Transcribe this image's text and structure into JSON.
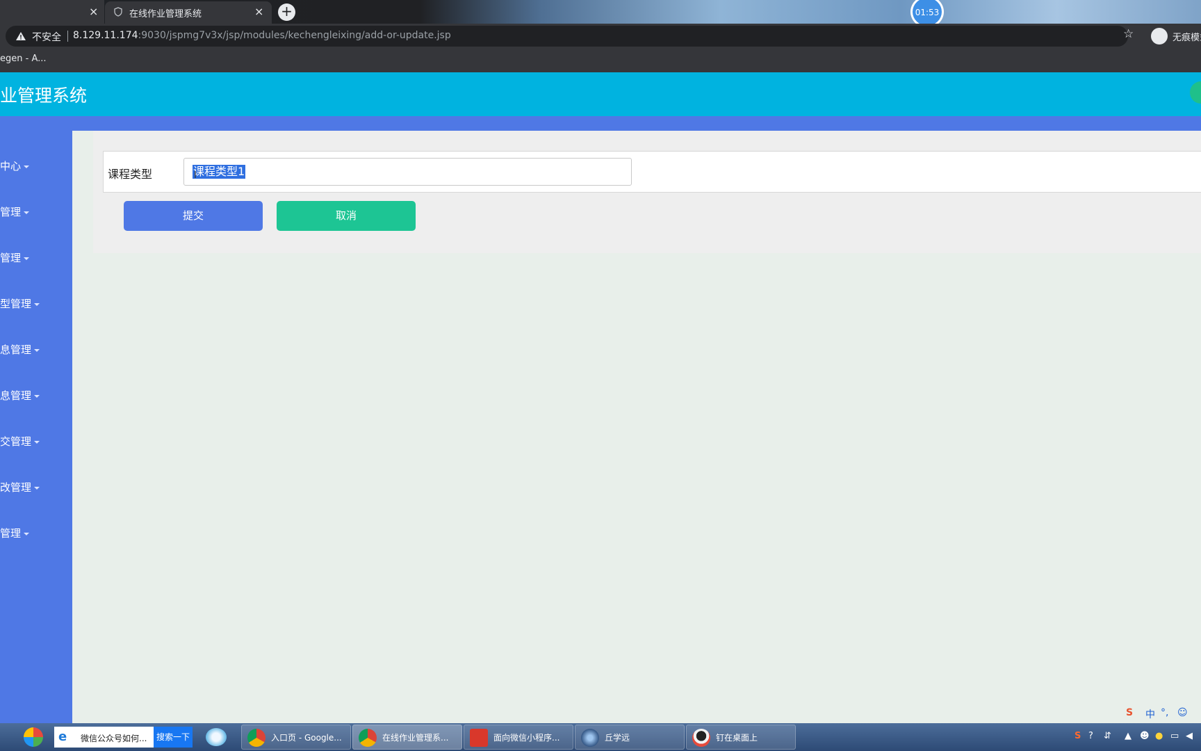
{
  "browser": {
    "prev_tab_close": "×",
    "active_tab": {
      "title": "在线作业管理系统",
      "close": "×"
    },
    "new_tab": "+",
    "timer": "01:53",
    "security_label": "不安全",
    "url_host": "8.129.11.174",
    "url_rest": ":9030/jspmg7v3x/jsp/modules/kechengleixing/add-or-update.jsp",
    "star": "☆",
    "incognito_label": "无痕模式",
    "bookmark": "egen - A..."
  },
  "app": {
    "title": "业管理系统"
  },
  "sidebar": {
    "items": [
      {
        "label": "中心"
      },
      {
        "label": "管理"
      },
      {
        "label": "管理"
      },
      {
        "label": "型管理"
      },
      {
        "label": "息管理"
      },
      {
        "label": "息管理"
      },
      {
        "label": "交管理"
      },
      {
        "label": "改管理"
      },
      {
        "label": "管理"
      }
    ]
  },
  "form": {
    "field_label": "课程类型",
    "field_value": "课程类型1",
    "submit_label": "提交",
    "cancel_label": "取消"
  },
  "ime": {
    "s": "S",
    "lang": "中",
    "punct": "°,",
    "face": "☺"
  },
  "taskbar": {
    "ie_search_text": "微信公众号如何...",
    "search_button": "搜索一下",
    "items": [
      {
        "label": "入口页 - Google..."
      },
      {
        "label": "在线作业管理系..."
      },
      {
        "label": "面向微信小程序..."
      },
      {
        "label": "丘学远"
      },
      {
        "label": "钉在桌面上"
      }
    ]
  },
  "colors": {
    "header": "#00b3e0",
    "sidebar": "#4f78e5",
    "submit": "#4f78e5",
    "cancel": "#1dc594",
    "selection": "#2f6fe0"
  }
}
